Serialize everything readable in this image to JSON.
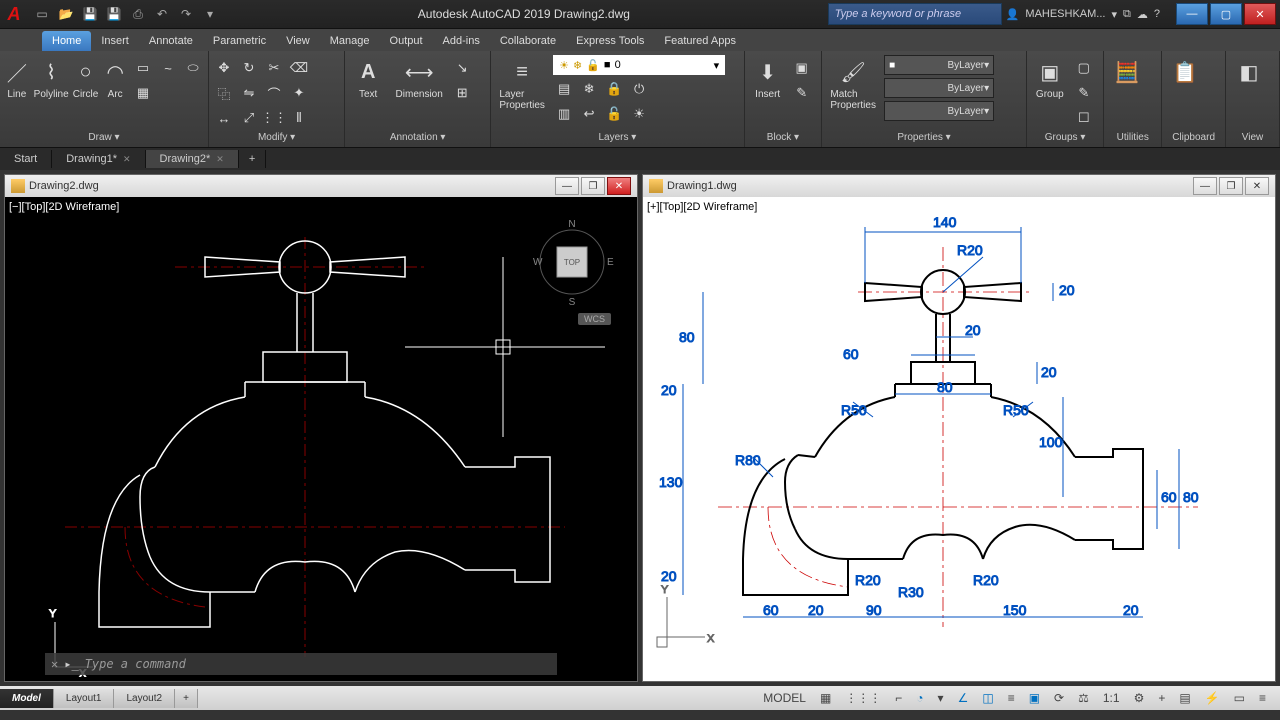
{
  "app": {
    "title": "Autodesk AutoCAD 2019   Drawing2.dwg",
    "logo": "A",
    "search_placeholder": "Type a keyword or phrase",
    "user": "MAHESHKAM..."
  },
  "qat": [
    "new",
    "open",
    "save",
    "saveas",
    "print",
    "undo",
    "redo"
  ],
  "ribbon_tabs": [
    "Home",
    "Insert",
    "Annotate",
    "Parametric",
    "View",
    "Manage",
    "Output",
    "Add-ins",
    "Collaborate",
    "Express Tools",
    "Featured Apps"
  ],
  "active_ribbon_tab": "Home",
  "panels": {
    "draw": {
      "title": "Draw ▾",
      "tools": {
        "line": "Line",
        "polyline": "Polyline",
        "circle": "Circle",
        "arc": "Arc"
      }
    },
    "modify": {
      "title": "Modify ▾"
    },
    "annotation": {
      "title": "Annotation ▾",
      "text": "Text",
      "dimension": "Dimension"
    },
    "layers": {
      "title": "Layers ▾",
      "layer_props": "Layer\nProperties",
      "current_layer": "0"
    },
    "block": {
      "title": "Block ▾",
      "insert": "Insert"
    },
    "properties": {
      "title": "Properties ▾",
      "match": "Match\nProperties",
      "color": "ByLayer",
      "ltype": "ByLayer",
      "lweight": "ByLayer"
    },
    "groups": {
      "title": "Groups ▾",
      "group": "Group"
    },
    "utilities": {
      "title": "Utilities"
    },
    "clipboard": {
      "title": "Clipboard"
    },
    "view": {
      "title": "View"
    }
  },
  "doc_tabs": [
    "Start",
    "Drawing1*",
    "Drawing2*"
  ],
  "active_doc_tab": "Drawing2*",
  "left_doc": {
    "title": "Drawing2.dwg",
    "view_label": "[−][Top][2D Wireframe]",
    "viewcube": {
      "n": "N",
      "s": "S",
      "e": "E",
      "w": "W",
      "top": "TOP",
      "wcs": "WCS"
    },
    "cmd_prompt": "Type a command"
  },
  "right_doc": {
    "title": "Drawing1.dwg",
    "view_label": "[+][Top][2D Wireframe]",
    "dimensions": {
      "d140": "140",
      "r20": "R20",
      "d20a": "20",
      "d20b": "20",
      "d20c": "20",
      "d20d": "20",
      "d20e": "20",
      "d20f": "20",
      "d80a": "80",
      "d80b": "80",
      "d80c": "80",
      "d60a": "60",
      "d60b": "60",
      "d60c": "60",
      "r50a": "R50",
      "r50b": "R50",
      "r80": "R80",
      "d130": "130",
      "d100": "100",
      "r20a": "R20",
      "r20b": "R20",
      "r30": "R30",
      "d90": "90",
      "d150": "150"
    }
  },
  "model_tabs": [
    "Model",
    "Layout1",
    "Layout2"
  ],
  "active_model_tab": "Model",
  "status": {
    "model": "MODEL",
    "scale": "1:1"
  }
}
